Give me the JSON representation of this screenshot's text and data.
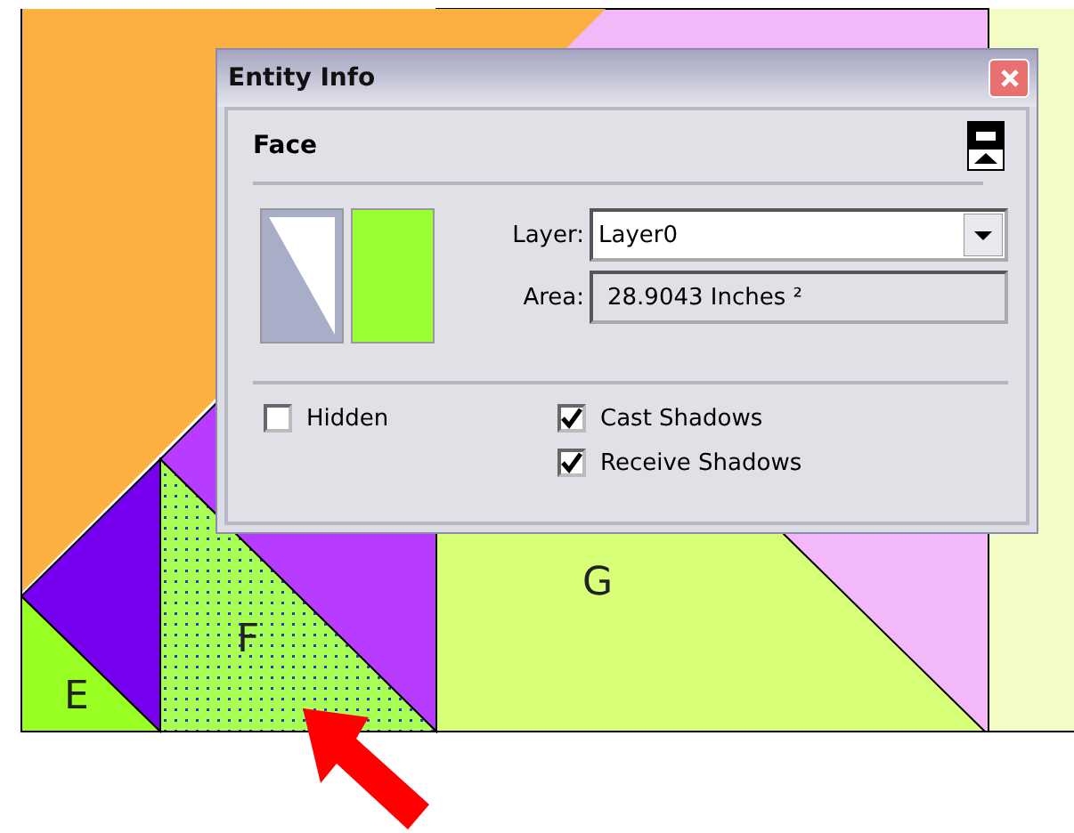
{
  "canvas": {
    "labels": [
      {
        "text": "E",
        "selected": false
      },
      {
        "text": "F",
        "selected": true
      },
      {
        "text": "G",
        "selected": false
      }
    ]
  },
  "dialog": {
    "title": "Entity Info",
    "section": "Face",
    "fields": [
      {
        "kind": "dropdown",
        "label": "Layer:",
        "value": "Layer0"
      },
      {
        "kind": "readonly",
        "label": "Area:",
        "value": "28.9043 Inches ²"
      }
    ],
    "options": [
      {
        "label": "Hidden",
        "checked": false
      },
      {
        "label": "Cast Shadows",
        "checked": true
      },
      {
        "label": "Receive Shadows",
        "checked": true
      }
    ]
  }
}
